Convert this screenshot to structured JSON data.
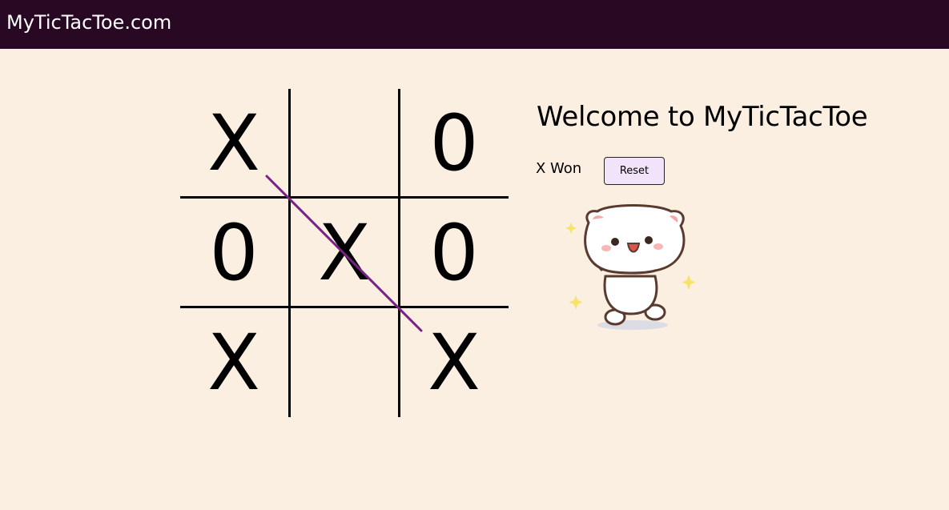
{
  "navbar": {
    "brand": "MyTicTacToe.com"
  },
  "board": {
    "cells": [
      "X",
      "",
      "0",
      "0",
      "X",
      "0",
      "X",
      "",
      "X"
    ],
    "winning_line": "diagonal-top-left-to-bottom-right"
  },
  "panel": {
    "title": "Welcome to MyTicTacToe",
    "status": "X Won",
    "reset_label": "Reset"
  },
  "colors": {
    "navbar_bg": "#280823",
    "page_bg": "#faefe1",
    "win_line": "#7b1f84",
    "reset_bg": "#f1e4fa"
  },
  "icons": {
    "celebration": "dancing-cat-sticker"
  }
}
